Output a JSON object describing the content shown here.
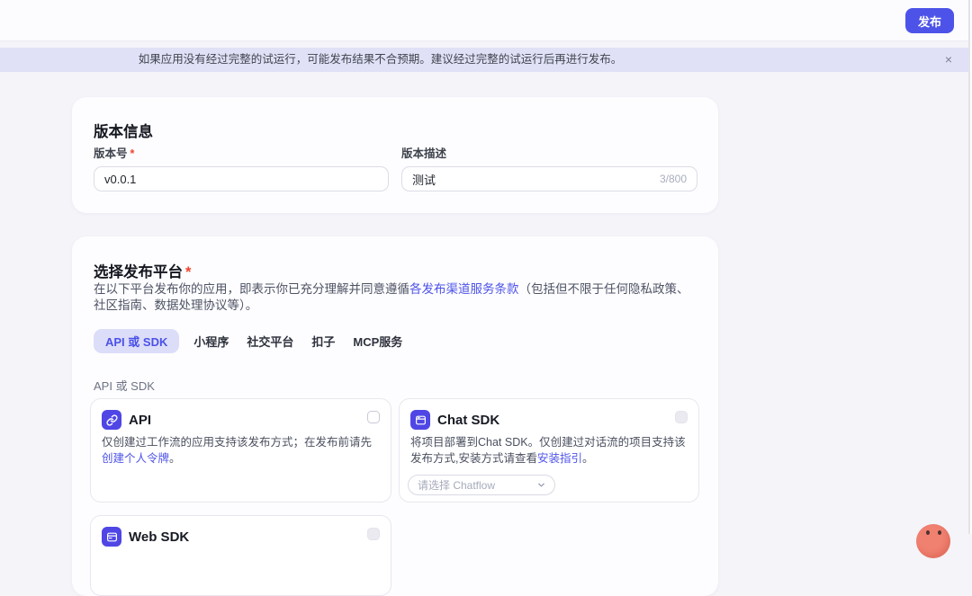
{
  "header": {
    "publish_button": "发布"
  },
  "banner": {
    "message": "如果应用没有经过完整的试运行，可能发布结果不合预期。建议经过完整的试运行后再进行发布。",
    "close": "×"
  },
  "version": {
    "title": "版本信息",
    "number_label": "版本号",
    "required": "*",
    "number_value": "v0.0.1",
    "desc_label": "版本描述",
    "desc_value": "测试",
    "counter": "3/800"
  },
  "platform": {
    "title": "选择发布平台",
    "required": "*",
    "agreement_prefix": "在以下平台发布你的应用，即表示你已充分理解并同意遵循",
    "agreement_link": "各发布渠道服务条款",
    "agreement_suffix": "（包括但不限于任何隐私政策、社区指南、数据处理协议等）。",
    "tabs": [
      {
        "label": "API 或 SDK"
      },
      {
        "label": "小程序"
      },
      {
        "label": "社交平台"
      },
      {
        "label": "扣子"
      },
      {
        "label": "MCP服务"
      }
    ],
    "group_label": "API 或 SDK",
    "api_card": {
      "title": "API",
      "desc_prefix": "仅创建过工作流的应用支持该发布方式；在发布前请先",
      "desc_link": "创建个人令牌",
      "desc_suffix": "。"
    },
    "chat_card": {
      "title": "Chat SDK",
      "desc_prefix": "将项目部署到Chat SDK。仅创建过对话流的项目支持该发布方式,安装方式请查看",
      "desc_link": "安装指引",
      "desc_suffix": "。",
      "select_placeholder": "请选择 Chatflow"
    },
    "web_card": {
      "title": "Web SDK"
    }
  },
  "colors": {
    "primary": "#4D53E8",
    "banner_bg": "#E0E1F6",
    "page_bg": "#F4F4F9",
    "tab_active_bg": "#DCDDF8",
    "required_red": "#F0442B",
    "mascot": "#F08070"
  }
}
